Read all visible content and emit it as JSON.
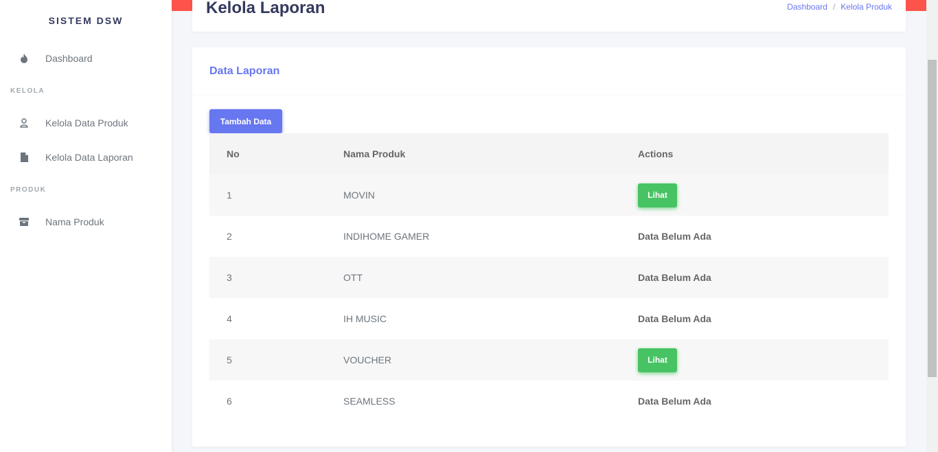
{
  "app": {
    "brand": "SISTEM DSW"
  },
  "sidebar": {
    "dashboard": {
      "label": "Dashboard",
      "icon": "fire-icon"
    },
    "section_kelola": "KELOLA",
    "kelola_items": [
      {
        "label": "Kelola Data Produk",
        "icon": "user-icon"
      },
      {
        "label": "Kelola Data Laporan",
        "icon": "file-icon"
      }
    ],
    "section_produk": "PRODUK",
    "produk_items": [
      {
        "label": "Nama Produk",
        "icon": "box-icon"
      }
    ]
  },
  "header": {
    "title": "Kelola Laporan",
    "breadcrumb": [
      "Dashboard",
      "/",
      "Kelola Produk"
    ]
  },
  "card": {
    "title": "Data Laporan",
    "add_button": "Tambah Data"
  },
  "table": {
    "columns": [
      "No",
      "Nama Produk",
      "Actions"
    ],
    "rows": [
      {
        "no": "1",
        "name": "MOVIN",
        "action": "Lihat",
        "has_data": true
      },
      {
        "no": "2",
        "name": "INDIHOME GAMER",
        "action": "Data Belum Ada",
        "has_data": false
      },
      {
        "no": "3",
        "name": "OTT",
        "action": "Data Belum Ada",
        "has_data": false
      },
      {
        "no": "4",
        "name": "IH MUSIC",
        "action": "Data Belum Ada",
        "has_data": false
      },
      {
        "no": "5",
        "name": "VOUCHER",
        "action": "Lihat",
        "has_data": true
      },
      {
        "no": "6",
        "name": "SEAMLESS",
        "action": "Data Belum Ada",
        "has_data": false
      }
    ]
  },
  "colors": {
    "primary": "#6777ef",
    "success": "#47c363",
    "danger": "#fc544b",
    "title": "#34395e"
  }
}
